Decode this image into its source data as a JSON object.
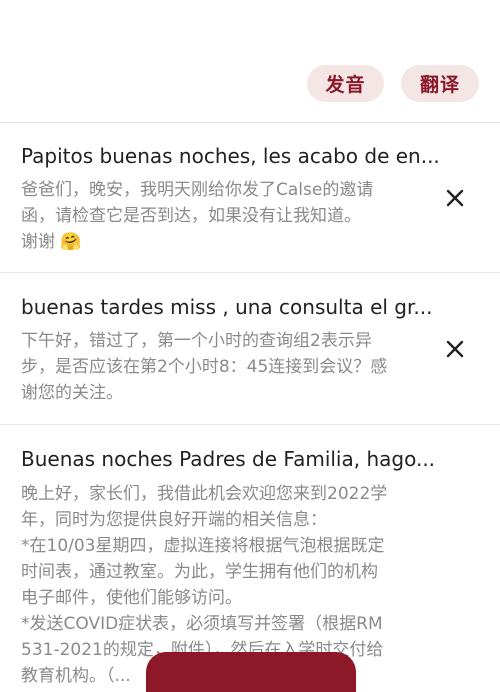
{
  "header": {
    "pronounce_label": "发音",
    "translate_label": "翻译"
  },
  "items": [
    {
      "title": "Papitos buenas noches, les acabo de en...",
      "body": "爸爸们，晚安，我明天刚给你发了Calse的邀请\n函，请检查它是否到达，如果没有让我知道。\n谢谢 🤗"
    },
    {
      "title": "buenas tardes miss , una consulta el gr...",
      "body": "下午好，错过了，第一个小时的查询组2表示异\n步，是否应该在第2个小时8：45连接到会议？感\n谢您的关注。"
    },
    {
      "title": "Buenas noches Padres de Familia, hago...",
      "body": "晚上好，家长们，我借此机会欢迎您来到2022学\n年，同时为您提供良好开端的相关信息：\n*在10/03星期四，虚拟连接将根据气泡根据既定\n时间表，通过教室。为此，学生拥有他们的机构\n电子邮件，使他们能够访问。\n*发送COVID症状表，必须填写并签署（根据RM\n531-2021的规定，附件），然后在入学时交付给\n教育机构。（..."
    }
  ],
  "colors": {
    "accent": "#8c1828",
    "pill_bg": "#f5e6e6"
  }
}
